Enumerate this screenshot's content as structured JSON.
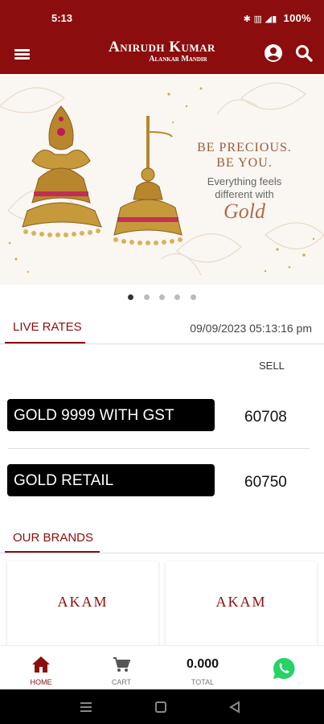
{
  "status_bar": {
    "time": "5:13",
    "battery": "100%",
    "icons": "✱ ▥ ◢▮"
  },
  "header": {
    "title": "Anirudh Kumar",
    "subtitle": "Alankar Mandir"
  },
  "banner": {
    "line1": "BE PRECIOUS.",
    "line2": "BE YOU.",
    "tagline": "Everything feels different with",
    "script": "Gold",
    "slide_count": 5,
    "active_slide": 1
  },
  "live_rates": {
    "tab_label": "LIVE RATES",
    "timestamp": "09/09/2023 05:13:16 pm",
    "column_header": "SELL",
    "rows": [
      {
        "label": "GOLD 9999 WITH GST",
        "sell": "60708"
      },
      {
        "label": "GOLD RETAIL",
        "sell": "60750"
      }
    ]
  },
  "brands": {
    "tab_label": "OUR BRANDS",
    "items": [
      {
        "name": "AKAM"
      },
      {
        "name": "AKAM"
      }
    ]
  },
  "bottom_nav": {
    "home": "HOME",
    "cart": "CART",
    "total_label": "TOTAL",
    "total_value": "0.000"
  },
  "colors": {
    "brand": "#8b0d0d",
    "whatsapp": "#25d366"
  }
}
